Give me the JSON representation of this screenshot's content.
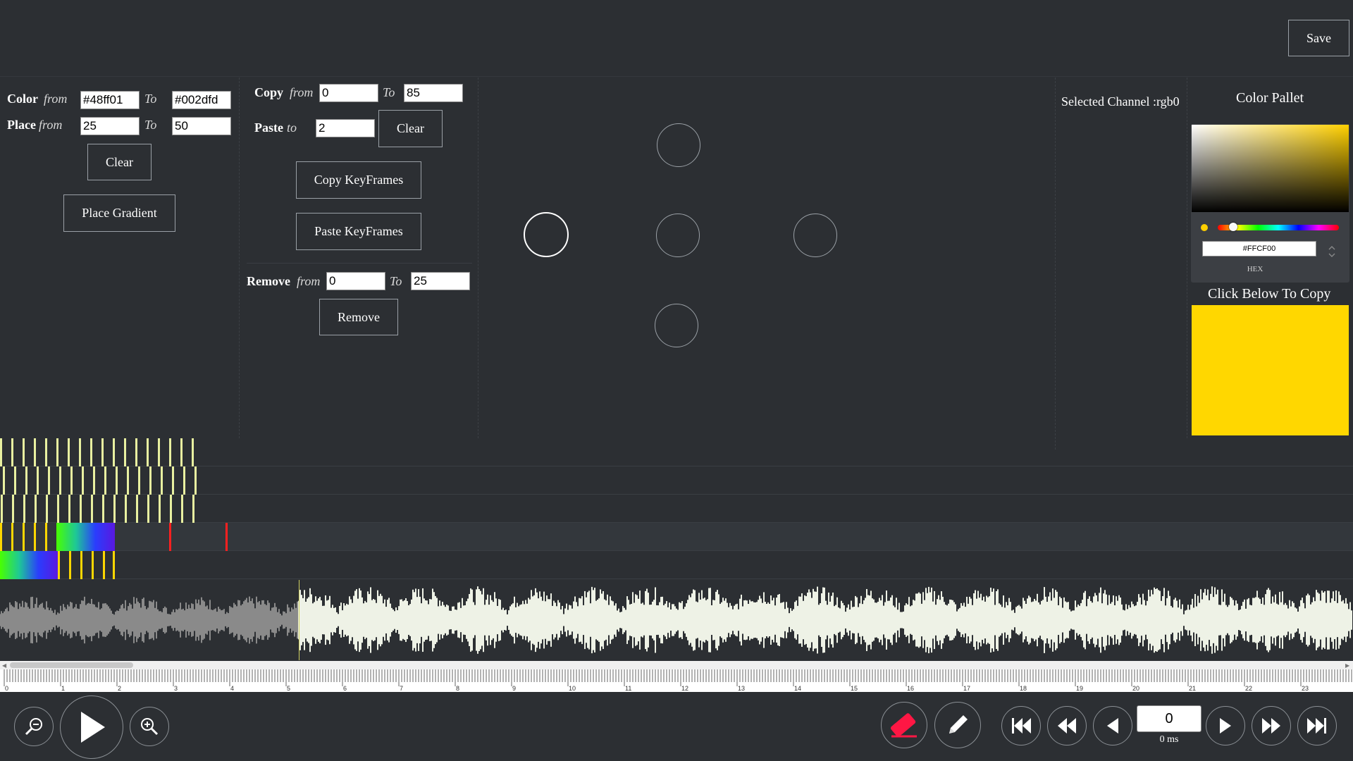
{
  "toolbar": {
    "save_label": "Save"
  },
  "gradient": {
    "color_label": "Color",
    "from_label": "from",
    "to_label": "To",
    "color_from": "#48ff01",
    "color_to": "#002dfd",
    "place_label": "Place",
    "place_from_label": "from",
    "place_from": "25",
    "place_to": "50",
    "clear_label": "Clear",
    "place_gradient_label": "Place Gradient"
  },
  "copy": {
    "copy_label": "Copy",
    "from_label": "from",
    "to_label": "To",
    "copy_from": "0",
    "copy_to": "85",
    "paste_label": "Paste",
    "paste_to_label": "to",
    "paste_to": "2",
    "clear_label": "Clear",
    "copy_keyframes_label": "Copy KeyFrames",
    "paste_keyframes_label": "Paste KeyFrames"
  },
  "remove": {
    "remove_label": "Remove",
    "from_label": "from",
    "to_label": "To",
    "remove_from": "0",
    "remove_to": "25",
    "remove_button_label": "Remove"
  },
  "channel": {
    "selected_text": "Selected Channel :rgb0"
  },
  "palette": {
    "title": "Color Pallet",
    "hex_value": "#FFCF00",
    "hex_label": "HEX",
    "copy_hint": "Click Below To Copy",
    "swatch_color": "#ffd700",
    "hue_fraction": 0.13
  },
  "timeline": {
    "ruler_labels": [
      "0",
      "1",
      "2",
      "3",
      "4",
      "5",
      "6",
      "7",
      "8",
      "9",
      "10",
      "11",
      "12",
      "13",
      "14",
      "15",
      "16",
      "17",
      "18",
      "19",
      "20",
      "21",
      "22",
      "23"
    ],
    "frame_value": "0",
    "time_text": "0 ms"
  },
  "colors": {
    "background": "#2c2f33",
    "keyframe_pale": "#e8f0a0",
    "keyframe_yellow": "#ffd700",
    "keyframe_red": "#ff2020",
    "waveform_played": "#8a8a8a",
    "waveform_unplayed": "#eef2e6",
    "eraser_accent": "#ff1744"
  },
  "icons": [
    "zoom-out-icon",
    "play-icon",
    "zoom-in-icon",
    "eraser-icon",
    "pencil-icon",
    "skip-to-start-icon",
    "rewind-icon",
    "step-back-icon",
    "step-forward-icon",
    "fast-forward-icon",
    "skip-to-end-icon",
    "chevron-up-down-icon"
  ]
}
